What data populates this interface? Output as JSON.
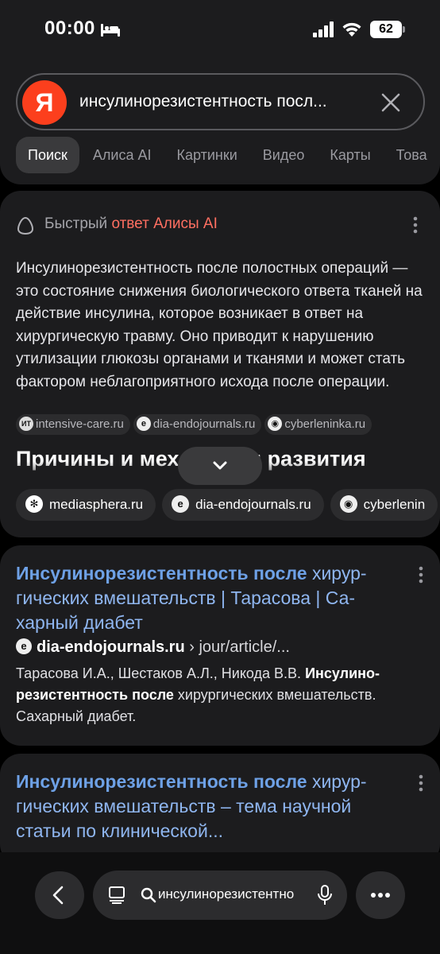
{
  "status_bar": {
    "time": "00:00",
    "battery": "62"
  },
  "search": {
    "logo": "Я",
    "query": "инсулинорезистентность посл..."
  },
  "tabs": [
    {
      "label": "Поиск",
      "active": true
    },
    {
      "label": "Алиса AI"
    },
    {
      "label": "Картинки"
    },
    {
      "label": "Видео"
    },
    {
      "label": "Карты"
    },
    {
      "label": "Това"
    }
  ],
  "quick_answer": {
    "header_prefix": "Быстрый ",
    "header_accent": "ответ Алисы AI",
    "text": "Инсулинорезистентность после полостных операций — это состояние снижения биологического ответа тканей на действие инсулина, которое возникает в ответ на хирургическую травму. Оно приводит к нарушению утилизации глюкозы органами и тканями и может стать фактором неблагоприятного исхода после операции.",
    "sources": [
      {
        "icon": "ИТ",
        "label": "intensive-care.ru"
      },
      {
        "icon": "e",
        "label": "dia-endojournals.ru"
      },
      {
        "icon": "◉",
        "label": "cyberleninka.ru"
      }
    ],
    "section_title": "Причины и механизмы развития",
    "more_sources": [
      {
        "icon": "✻",
        "label": "mediasphera.ru"
      },
      {
        "icon": "e",
        "label": "dia-endojournals.ru"
      },
      {
        "icon": "◉",
        "label": "cyberlenin"
      }
    ]
  },
  "results": [
    {
      "title_bold": "Инсулинорезистентность после",
      "title_rest": " хирур-гических вмешательств | Тарасова | Са-харный диабет",
      "host": "dia-endojournals.ru",
      "path": " › jour/article/...",
      "snippet_pre": "Тарасова И.А., Шестаков А.Л., Никода В.В. ",
      "snippet_bold": "Инсулино-резистентность после",
      "snippet_post": " хирургических вмешательств. Сахарный диабет."
    },
    {
      "title_bold": "Инсулинорезистентность после",
      "title_rest": " хирур-гических вмешательств – тема научной статьи по клинической..."
    }
  ],
  "bottom_bar": {
    "omnibox_text": "инсулинорезистентно"
  },
  "colors": {
    "accent": "#ff6f61",
    "link": "#6ea1e6",
    "yandex": "#fc3f1d"
  }
}
